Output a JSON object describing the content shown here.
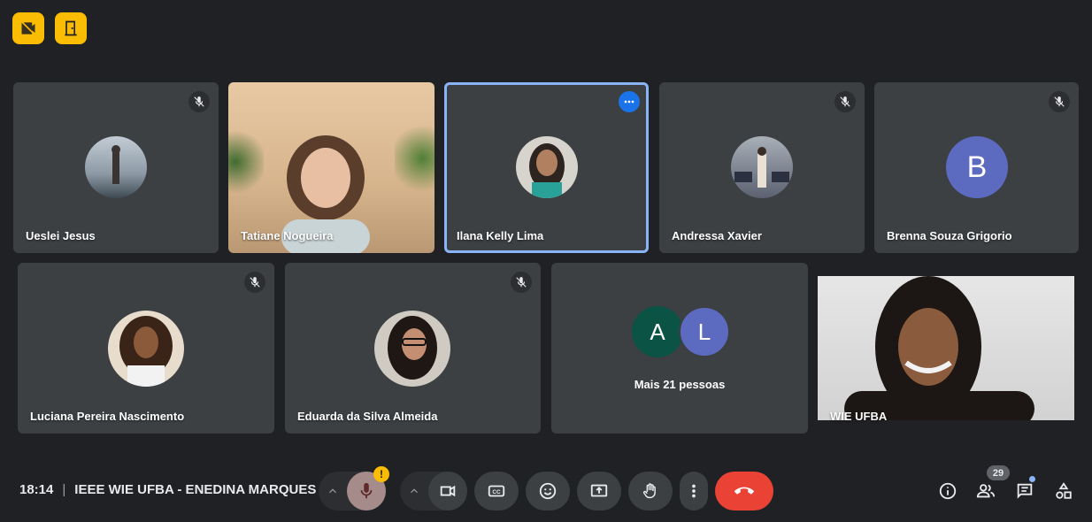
{
  "top_icons": [
    {
      "icon": "video-off-icon"
    },
    {
      "icon": "door-exit-icon"
    }
  ],
  "participants_row1": [
    {
      "name": "Ueslei Jesus",
      "muted": true,
      "avatar_type": "photo",
      "avatar_color": "#8d9aa6"
    },
    {
      "name": "Tatiane Nogueira",
      "muted": false,
      "avatar_type": "video",
      "avatar_color": "#c9a57f"
    },
    {
      "name": "Ilana Kelly Lima",
      "muted": false,
      "active": true,
      "avatar_type": "photo",
      "avatar_color": "#6a5445"
    },
    {
      "name": "Andressa Xavier",
      "muted": true,
      "avatar_type": "photo",
      "avatar_color": "#5b6170"
    },
    {
      "name": "Brenna Souza Grigorio",
      "muted": true,
      "avatar_type": "initial",
      "initial": "B",
      "avatar_color": "#5c6bc0"
    }
  ],
  "participants_row2": [
    {
      "name": "Luciana Pereira Nascimento",
      "muted": true,
      "avatar_type": "photo",
      "avatar_color": "#7a5a3c"
    },
    {
      "name": "Eduarda da Silva Almeida",
      "muted": true,
      "avatar_type": "photo",
      "avatar_color": "#4b4039"
    },
    {
      "name": "WIE UFBA",
      "muted": false,
      "avatar_type": "video",
      "avatar_color": "#d8d8d8"
    }
  ],
  "more_people": {
    "label": "Mais 21 pessoas",
    "initials": [
      {
        "letter": "A",
        "color": "#0b5345"
      },
      {
        "letter": "L",
        "color": "#5c6bc0"
      }
    ]
  },
  "meeting": {
    "time": "18:14",
    "separator": "|",
    "title": "IEEE WIE UFBA - ENEDINA MARQUES"
  },
  "controls": {
    "warning_badge": "!",
    "end_call_color": "#ea4335",
    "mic_button_color": "#a68b8b"
  },
  "right_panel": {
    "participants_count": "29"
  },
  "colors": {
    "background": "#202124",
    "tile": "#3c4043",
    "accent_blue": "#8ab4f8",
    "yellow": "#fbbc04"
  }
}
